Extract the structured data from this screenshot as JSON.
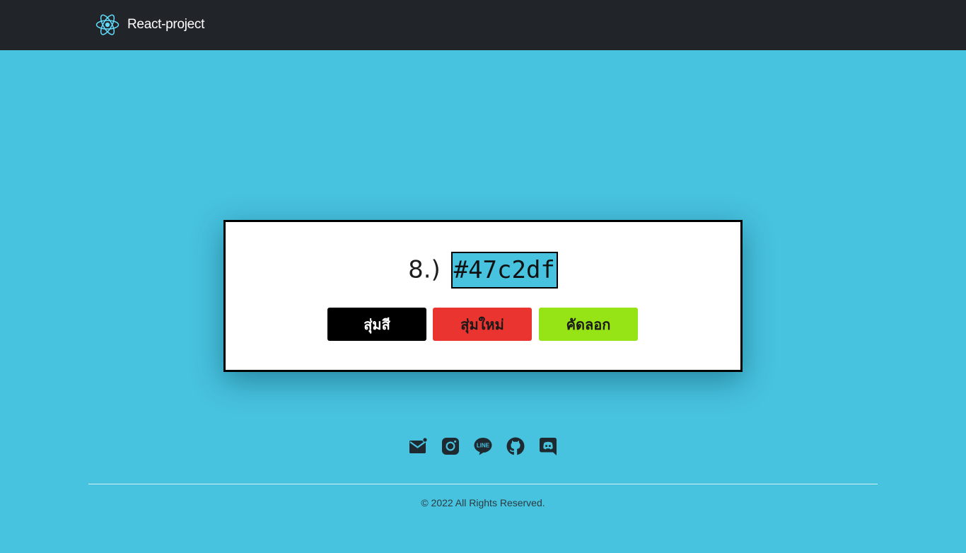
{
  "navbar": {
    "brand": "React-project",
    "logo_icon": "react-atom-icon",
    "background": "#212529",
    "logo_color": "#61dafb"
  },
  "page": {
    "background": "#47c2df"
  },
  "color_card": {
    "index_label": "8.)",
    "hex_value": "#47c2df",
    "hex_highlight": "#47c2df",
    "buttons": {
      "random_label": "สุ่มสี",
      "new_label": "สุ่มใหม่",
      "copy_label": "คัดลอก",
      "random_color": "#000000",
      "new_color": "#ea3430",
      "copy_color": "#96e316"
    }
  },
  "social_links": [
    {
      "icon": "email-icon"
    },
    {
      "icon": "instagram-icon"
    },
    {
      "icon": "line-icon"
    },
    {
      "icon": "github-icon"
    },
    {
      "icon": "discord-icon"
    }
  ],
  "footer": {
    "copyright": "© 2022 All Rights Reserved."
  }
}
